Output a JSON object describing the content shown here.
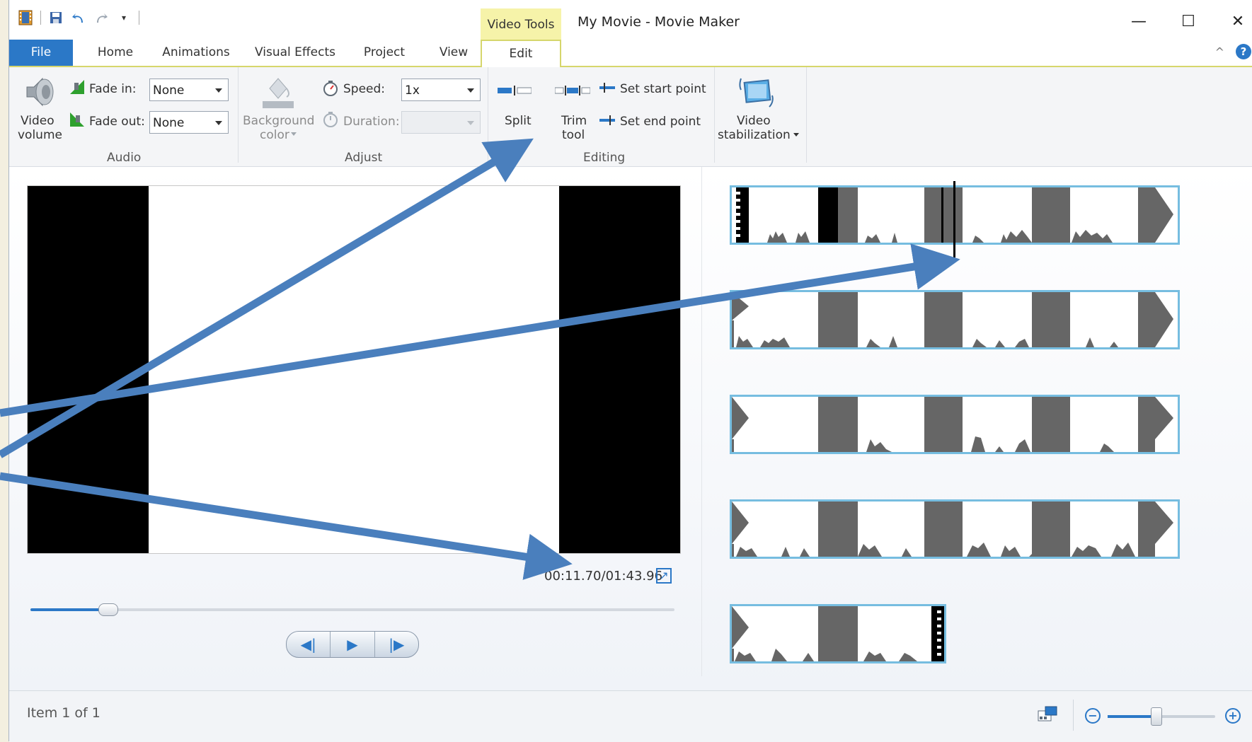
{
  "window": {
    "title": "My Movie - Movie Maker",
    "context_tab": "Video Tools",
    "controls": {
      "minimize": "—",
      "maximize": "☐",
      "close": "✕"
    }
  },
  "tabs": [
    "File",
    "Home",
    "Animations",
    "Visual Effects",
    "Project",
    "View",
    "Edit"
  ],
  "active_tab": "Edit",
  "ribbon": {
    "audio": {
      "video_volume_line1": "Video",
      "video_volume_line2": "volume",
      "fade_in_label": "Fade in:",
      "fade_in_value": "None",
      "fade_out_label": "Fade out:",
      "fade_out_value": "None",
      "group_label": "Audio"
    },
    "adjust": {
      "background_color_line1": "Background",
      "background_color_line2": "color",
      "speed_label": "Speed:",
      "speed_value": "1x",
      "duration_label": "Duration:",
      "duration_value": "",
      "group_label": "Adjust"
    },
    "editing": {
      "split": "Split",
      "trim_line1": "Trim",
      "trim_line2": "tool",
      "set_start": "Set start point",
      "set_end": "Set end point",
      "group_label": "Editing"
    },
    "stabilization": {
      "line1": "Video",
      "line2": "stabilization"
    }
  },
  "preview": {
    "timecode": "00:11.70/01:43.96",
    "seek_progress": 0.12
  },
  "status": {
    "item_text": "Item 1 of 1",
    "zoom_level": 0.45
  },
  "colors": {
    "accent": "#2b78c7",
    "context_tab": "#f6f3a9",
    "clip_border": "#76bde0",
    "annotation_arrow": "#4a7fbd"
  }
}
